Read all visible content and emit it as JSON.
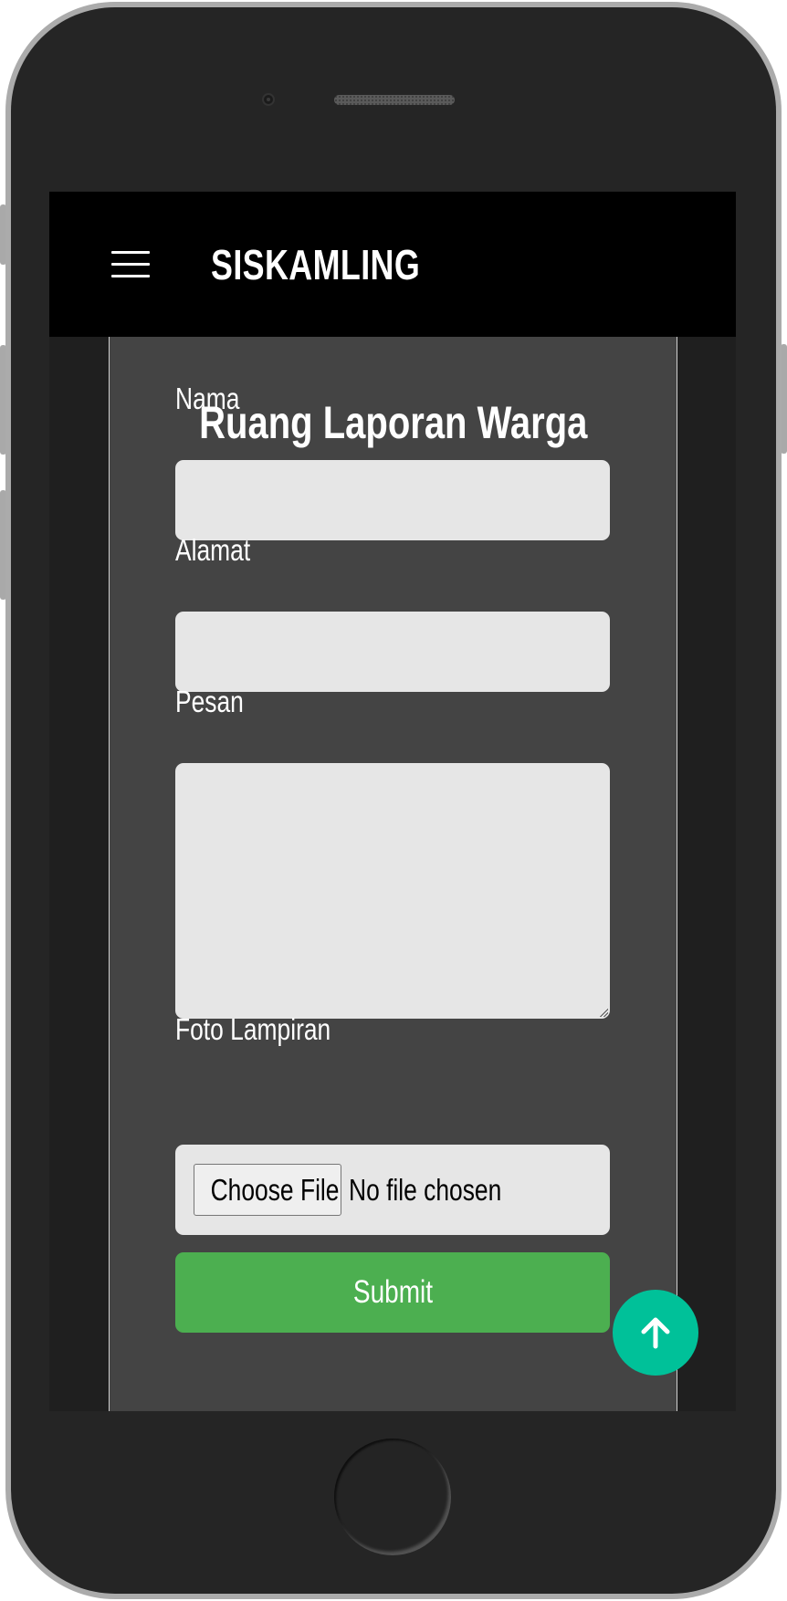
{
  "app": {
    "brand": "SISKAMLING"
  },
  "form": {
    "title": "Ruang Laporan Warga",
    "nama_label": "Nama",
    "nama_value": "",
    "alamat_label": "Alamat",
    "alamat_value": "",
    "pesan_label": "Pesan",
    "pesan_value": "",
    "foto_label": "Foto Lampiran",
    "file_button_label": "Choose File",
    "file_status": "No file chosen",
    "submit_label": "Submit"
  },
  "icons": {
    "menu": "hamburger-menu-icon",
    "scroll_top": "arrow-up-icon"
  },
  "colors": {
    "navbar": "#000000",
    "panel": "#444444",
    "submit": "#4caf50",
    "scroll_top": "#00c199"
  }
}
